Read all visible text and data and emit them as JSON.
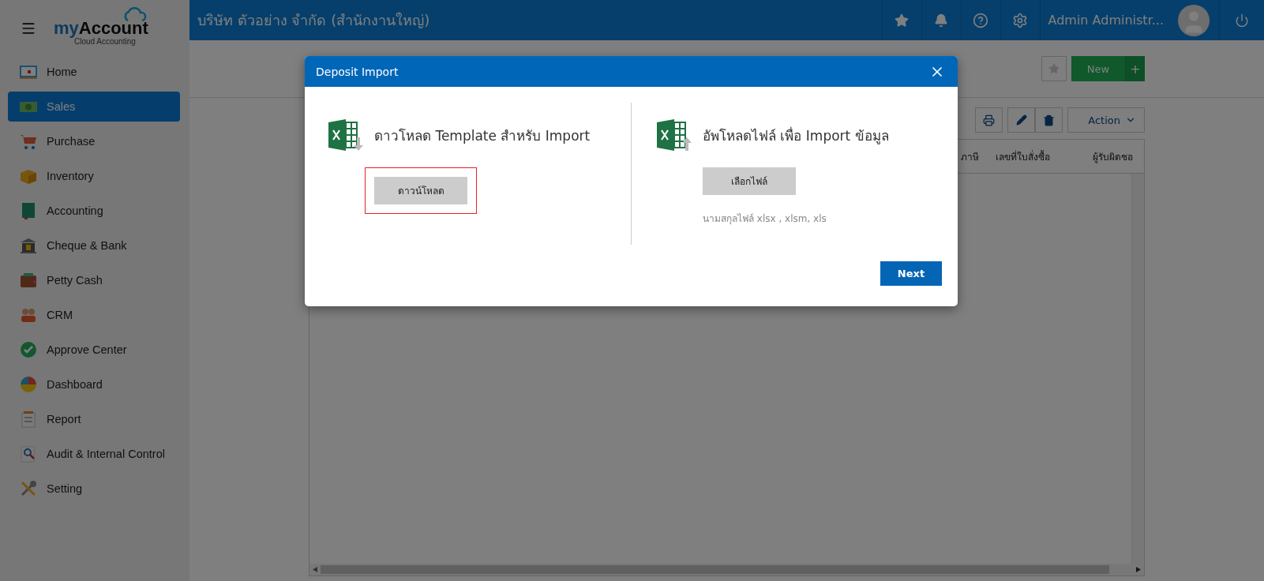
{
  "logo": {
    "prefix": "my",
    "main": "Account",
    "tagline": "Cloud Accounting"
  },
  "sidebar": {
    "items": [
      {
        "label": "Home",
        "selected": false
      },
      {
        "label": "Sales",
        "selected": true
      },
      {
        "label": "Purchase",
        "selected": false
      },
      {
        "label": "Inventory",
        "selected": false
      },
      {
        "label": "Accounting",
        "selected": false
      },
      {
        "label": "Cheque & Bank",
        "selected": false
      },
      {
        "label": "Petty Cash",
        "selected": false
      },
      {
        "label": "CRM",
        "selected": false
      },
      {
        "label": "Approve Center",
        "selected": false
      },
      {
        "label": "Dashboard",
        "selected": false
      },
      {
        "label": "Report",
        "selected": false
      },
      {
        "label": "Audit & Internal Control",
        "selected": false
      },
      {
        "label": "Setting",
        "selected": false
      }
    ]
  },
  "header": {
    "company": "บริษัท ตัวอย่าง จำกัด (สำนักงานใหญ่)",
    "user_name": "Admin Administr..."
  },
  "toolbar": {
    "new_button": "New",
    "add_button": "+",
    "action_button": "Action"
  },
  "table": {
    "columns": [
      "ภาษี",
      "เลขที่ใบสั่งซื้อ",
      "ผู้รับผิดชอ"
    ]
  },
  "modal": {
    "title": "Deposit Import",
    "sections": [
      {
        "kind": "download",
        "heading": "ดาวโหลด Template สำหรับ Import",
        "button": "ดาวน์โหลด",
        "highlighted": true
      },
      {
        "kind": "upload",
        "heading": "อัพโหลดไฟล์ เพื่อ Import ข้อมูล",
        "button": "เลือกไฟล์",
        "note": "นามสกุลไฟล์ xlsx , xlsm, xls",
        "highlighted": false
      }
    ],
    "next_button": "Next"
  }
}
